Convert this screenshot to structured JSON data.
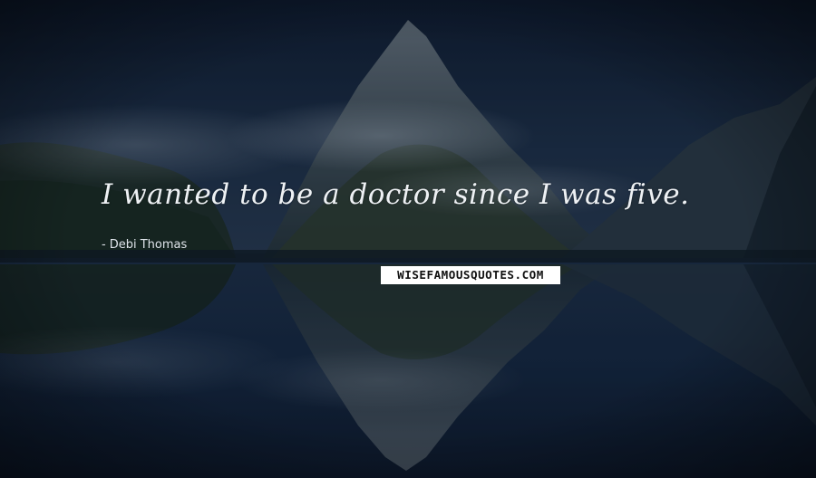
{
  "quote": {
    "text": "I wanted to be a doctor since I was five.",
    "author_dash": "-",
    "author": "Debi Thomas"
  },
  "brand": {
    "text": "WISEFAMOUSQUOTES.COM"
  },
  "colors": {
    "sky_top": "#0e1a2e",
    "sky_mid": "#1d2f47",
    "water": "#12223a",
    "mountain": "#3e4d57",
    "text": "#eef1f4"
  }
}
